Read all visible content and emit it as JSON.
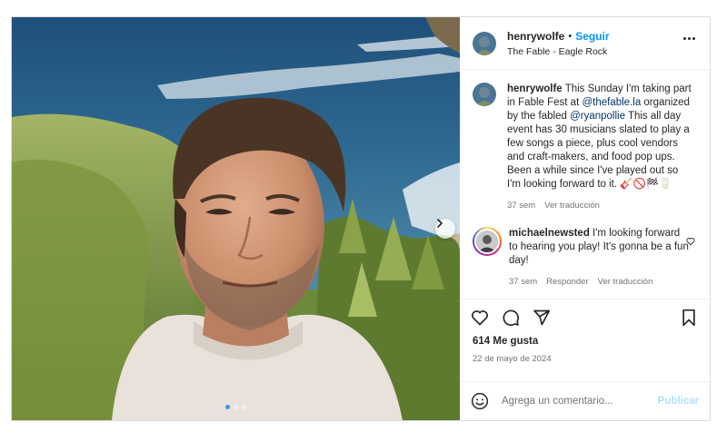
{
  "header": {
    "username": "henrywolfe",
    "separator": "•",
    "follow_label": "Seguir",
    "location": "The Fable - Eagle Rock",
    "more_icon": "more-options-icon"
  },
  "caption": {
    "username": "henrywolfe",
    "text_1": " This Sunday I'm taking part in Fable Fest at ",
    "mention_1": "@thefable.la",
    "text_2": " organized by the fabled ",
    "mention_2": "@ryanpollie",
    "text_3": " This all day event has 30 musicians slated to play a few songs a piece, plus cool vendors and craft-makers, and food pop ups. Been a while since I've played out so I'm looking forward to it. ",
    "emoji": "🎸🚫🏁🥛",
    "time": "37 sem",
    "translate": "Ver traducción"
  },
  "comment": {
    "username": "michaelnewsted",
    "text": " I'm looking forward to hearing you play! It's gonna be a fun day!",
    "time": "37 sem",
    "reply": "Responder",
    "translate": "Ver traducción"
  },
  "likes": "614 Me gusta",
  "date": "22 de mayo de 2024",
  "add_comment": {
    "placeholder": "Agrega un comentario...",
    "publish": "Publicar"
  },
  "carousel": {
    "count": 3,
    "active_index": 0
  },
  "colors": {
    "accent": "#0095f6",
    "mention": "#00376b",
    "muted": "#737373",
    "border": "#dbdbdb"
  }
}
